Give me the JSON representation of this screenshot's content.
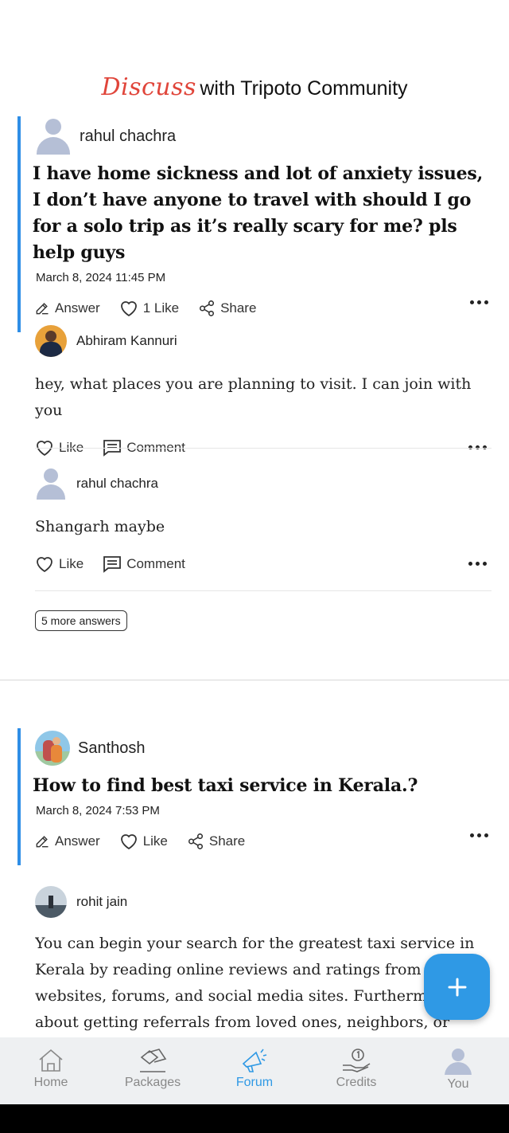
{
  "header": {
    "discuss": "Discuss",
    "rest": "with Tripoto Community"
  },
  "questions": [
    {
      "user": "rahul chachra",
      "title": "I have home sickness and lot of anxiety issues, I don’t have anyone to travel with should I go for a solo trip as it’s really scary for me? pls help guys",
      "date": "March 8, 2024 11:45 PM",
      "answer_label": "Answer",
      "like_label": "1 Like",
      "share_label": "Share"
    },
    {
      "user": "Santhosh",
      "title": "How to find best taxi service in Kerala.?",
      "date": "March 8, 2024 7:53 PM",
      "answer_label": "Answer",
      "like_label": "Like",
      "share_label": "Share"
    }
  ],
  "answers": [
    {
      "user": "Abhiram Kannuri",
      "text": "hey, what places you are planning to visit. I can join with you",
      "like_label": "Like",
      "comment_label": "Comment"
    },
    {
      "user": "rahul chachra",
      "text": "Shangarh maybe",
      "like_label": "Like",
      "comment_label": "Comment"
    },
    {
      "user": "rohit jain",
      "text": "You can begin your search for the greatest taxi service in Kerala by reading online reviews and ratings from reli websites, forums, and social media sites. Furthermor about getting referrals from loved ones, neighbors, or"
    }
  ],
  "more_answers_label": "5 more answers",
  "nav": [
    {
      "label": "Home",
      "icon": "home-icon"
    },
    {
      "label": "Packages",
      "icon": "packages-icon"
    },
    {
      "label": "Forum",
      "icon": "forum-megaphone-icon",
      "active": true
    },
    {
      "label": "Credits",
      "icon": "credits-coin-icon"
    },
    {
      "label": "You",
      "icon": "profile-icon"
    }
  ],
  "colors": {
    "accent": "#2f99e5",
    "discuss": "#e0453a",
    "question_bar": "#2f8ee6"
  }
}
